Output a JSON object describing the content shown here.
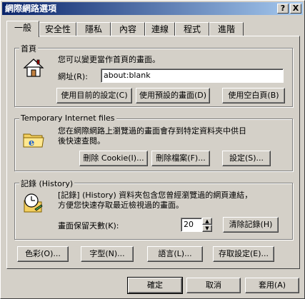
{
  "window": {
    "title": "網際網路選項",
    "help_button": "?",
    "close_button": "X"
  },
  "tabs": [
    {
      "label": "一般"
    },
    {
      "label": "安全性"
    },
    {
      "label": "隱私"
    },
    {
      "label": "內容"
    },
    {
      "label": "連線"
    },
    {
      "label": "程式"
    },
    {
      "label": "進階"
    }
  ],
  "homepage": {
    "title": "首頁",
    "description": "您可以變更當作首頁的畫面。",
    "address_label": "網址(R):",
    "address_value": "about:blank",
    "use_current_button": "使用目前的設定(C)",
    "use_default_button": "使用預設的畫面(D)",
    "use_blank_button": "使用空白頁(B)"
  },
  "temp_files": {
    "title": "Temporary Internet files",
    "description_line1": "您在網際網路上瀏覽過的畫面會存到特定資料夾中供日",
    "description_line2": "後快速查閱。",
    "delete_cookies_button": "刪除 Cookie(I)...",
    "delete_files_button": "刪除檔案(F)...",
    "settings_button": "設定(S)..."
  },
  "history": {
    "title": "記錄 (History)",
    "description_line1": "[記錄] (History) 資料夾包含您曾經瀏覽過的網頁連結，",
    "description_line2": "方便您快速存取最近檢視過的畫面。",
    "days_label": "畫面保留天數(K):",
    "days_value": "20",
    "clear_button": "清除記錄(H)"
  },
  "bottom_buttons": {
    "colors": "色彩(O)...",
    "fonts": "字型(N)...",
    "languages": "語言(L)...",
    "accessibility": "存取設定(E)..."
  },
  "dialog_buttons": {
    "ok": "確定",
    "cancel": "取消",
    "apply": "套用(A)"
  }
}
